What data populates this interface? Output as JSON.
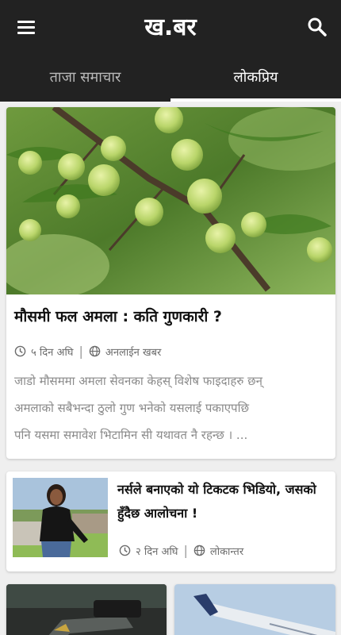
{
  "app": {
    "title": "ख.बर",
    "menu_icon": "hamburger-menu-icon",
    "search_icon": "search-icon",
    "colors": {
      "appbar": "#222222",
      "tab_active": "#ffffff",
      "tab_inactive": "#b8b8b8"
    }
  },
  "tabs": [
    {
      "label": "ताजा समाचार",
      "active": false
    },
    {
      "label": "लोकप्रिय",
      "active": true
    }
  ],
  "articles": [
    {
      "headline": "मौसमी फल अमला : कति गुणकारी ?",
      "time": "५ दिन अघि",
      "source": "अनलाईन खबर",
      "excerpt_lines": [
        "जाडो मौसममा अमला सेवनका केहस् विशेष फाइदाहरु छन्",
        "अमलाको सबैभन्दा ठुलो गुण भनेको यसलाई पकाएपछि",
        "पनि यसमा समावेश भिटामिन सी यथावत नै रहन्छ । ..."
      ]
    },
    {
      "headline": "नर्सले बनाएको यो टिकटक भिडियो, जसको हुँदैछ आलोचना !",
      "time": "२ दिन अघि",
      "source": "लोकान्तर"
    }
  ]
}
